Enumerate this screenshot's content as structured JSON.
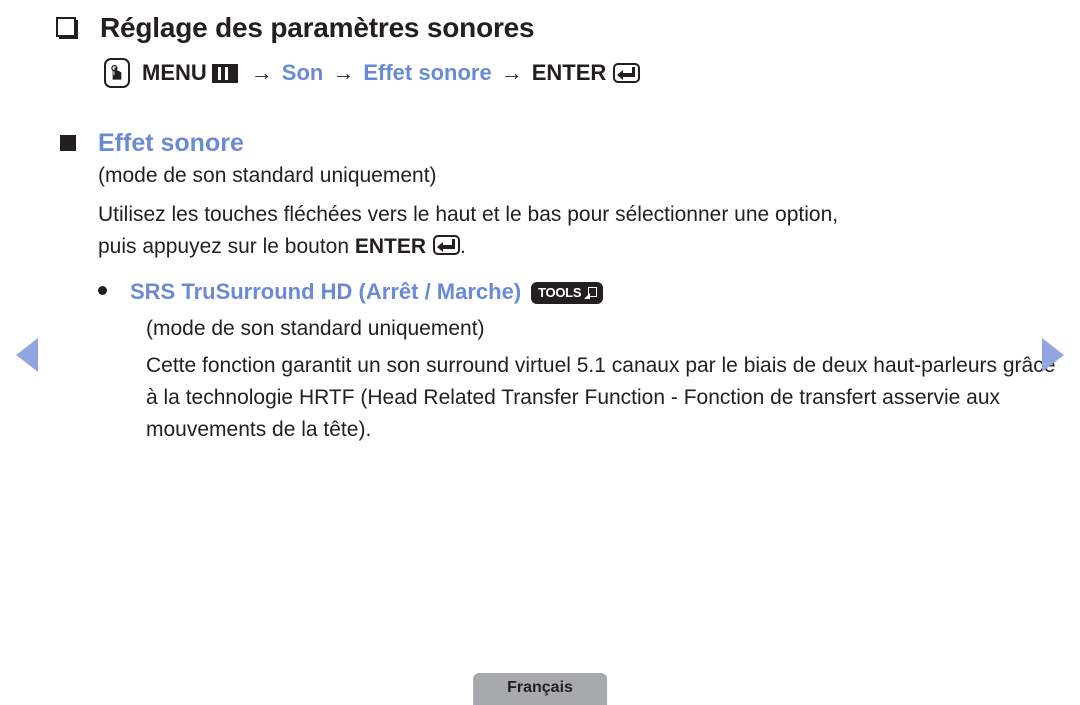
{
  "page": {
    "title": "Réglage des paramètres sonores",
    "language_badge": "Français"
  },
  "menu_path": {
    "remote_key_icon": "hand-press-key-icon",
    "menu_label": "MENU",
    "menu_icon": "menu-grid-icon",
    "sep1": "→",
    "item1": "Son",
    "sep2": "→",
    "item2": "Effet sonore",
    "sep3": "→",
    "enter_label": "ENTER",
    "enter_icon": "enter-return-key-icon"
  },
  "section": {
    "heading": "Effet sonore",
    "note": "(mode de son standard uniquement)",
    "instruction_line1": "Utilisez les touches fléchées vers le haut et le bas pour sélectionner une option,",
    "instruction_line2_pre": "puis appuyez sur le bouton ",
    "instruction_enter": "ENTER",
    "instruction_line2_post": ".",
    "bullet": {
      "label": "SRS TruSurround HD (Arrêt / Marche)",
      "badge": "TOOLS",
      "badge_icon": "tools-arrow-icon",
      "note": "(mode de son standard uniquement)",
      "description": "Cette fonction garantit un son surround virtuel 5.1 canaux par le biais de deux haut-parleurs grâce à la technologie HRTF (Head Related Transfer Function - Fonction de transfert asservie aux mouvements de la tête)."
    }
  },
  "navigation": {
    "prev_icon": "triangle-left-icon",
    "next_icon": "triangle-right-icon"
  },
  "colors": {
    "accent_blue": "#6b8ad6",
    "nav_arrow_blue": "#91a6e0",
    "text_black": "#231f20",
    "footer_gray": "#a7a9ac"
  }
}
